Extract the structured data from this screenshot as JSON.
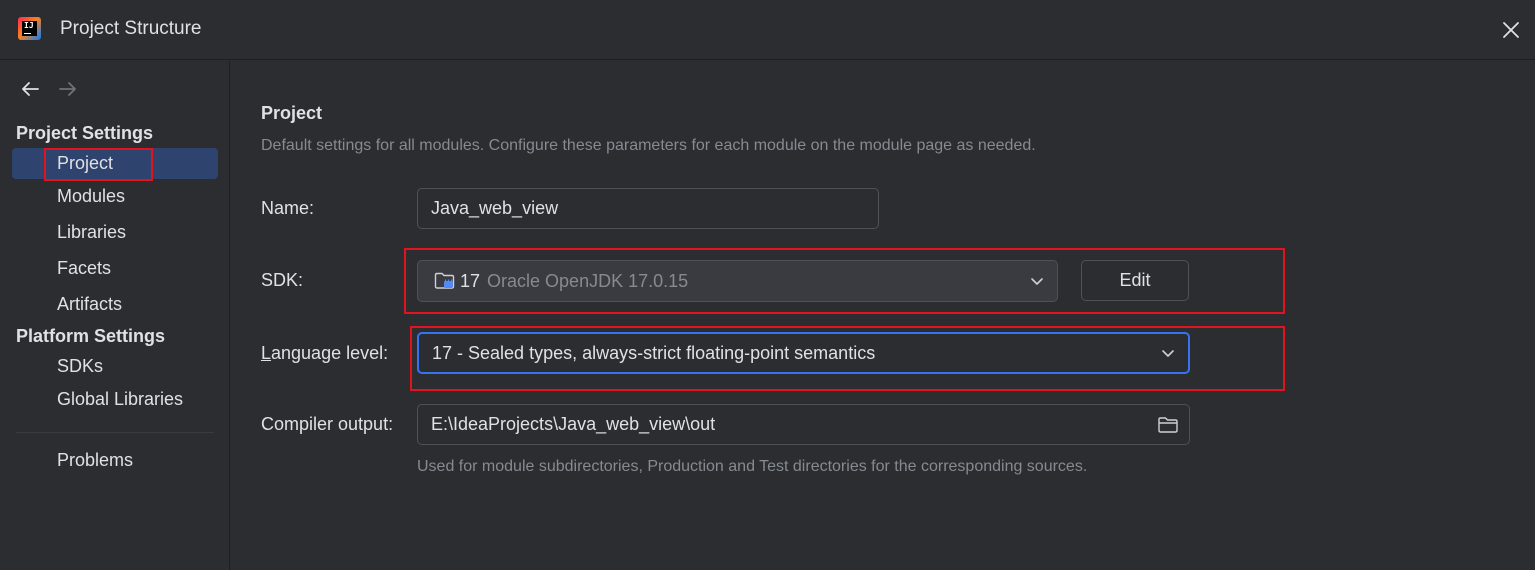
{
  "window": {
    "title": "Project Structure"
  },
  "sidebar": {
    "groups": [
      {
        "title": "Project Settings",
        "items": [
          "Project",
          "Modules",
          "Libraries",
          "Facets",
          "Artifacts"
        ]
      },
      {
        "title": "Platform Settings",
        "items": [
          "SDKs",
          "Global Libraries"
        ]
      }
    ],
    "extra_items": [
      "Problems"
    ],
    "selected": "Project"
  },
  "main": {
    "heading": "Project",
    "description": "Default settings for all modules. Configure these parameters for each module on the module page as needed.",
    "name_label": "Name:",
    "name_value": "Java_web_view",
    "sdk_label": "SDK:",
    "sdk_version": "17",
    "sdk_name": "Oracle OpenJDK 17.0.15",
    "edit_label": "Edit",
    "language_label_first": "L",
    "language_label_rest": "anguage level:",
    "language_value": "17 - Sealed types, always-strict floating-point semantics",
    "compiler_label": "Compiler output:",
    "compiler_value": "E:\\IdeaProjects\\Java_web_view\\out",
    "compiler_hint": "Used for module subdirectories, Production and Test directories for the corresponding sources."
  },
  "colors": {
    "background": "#2b2d30",
    "selection": "#2e436e",
    "focus": "#3574f0",
    "annotation": "#e0141e",
    "muted_text": "#868a91"
  }
}
